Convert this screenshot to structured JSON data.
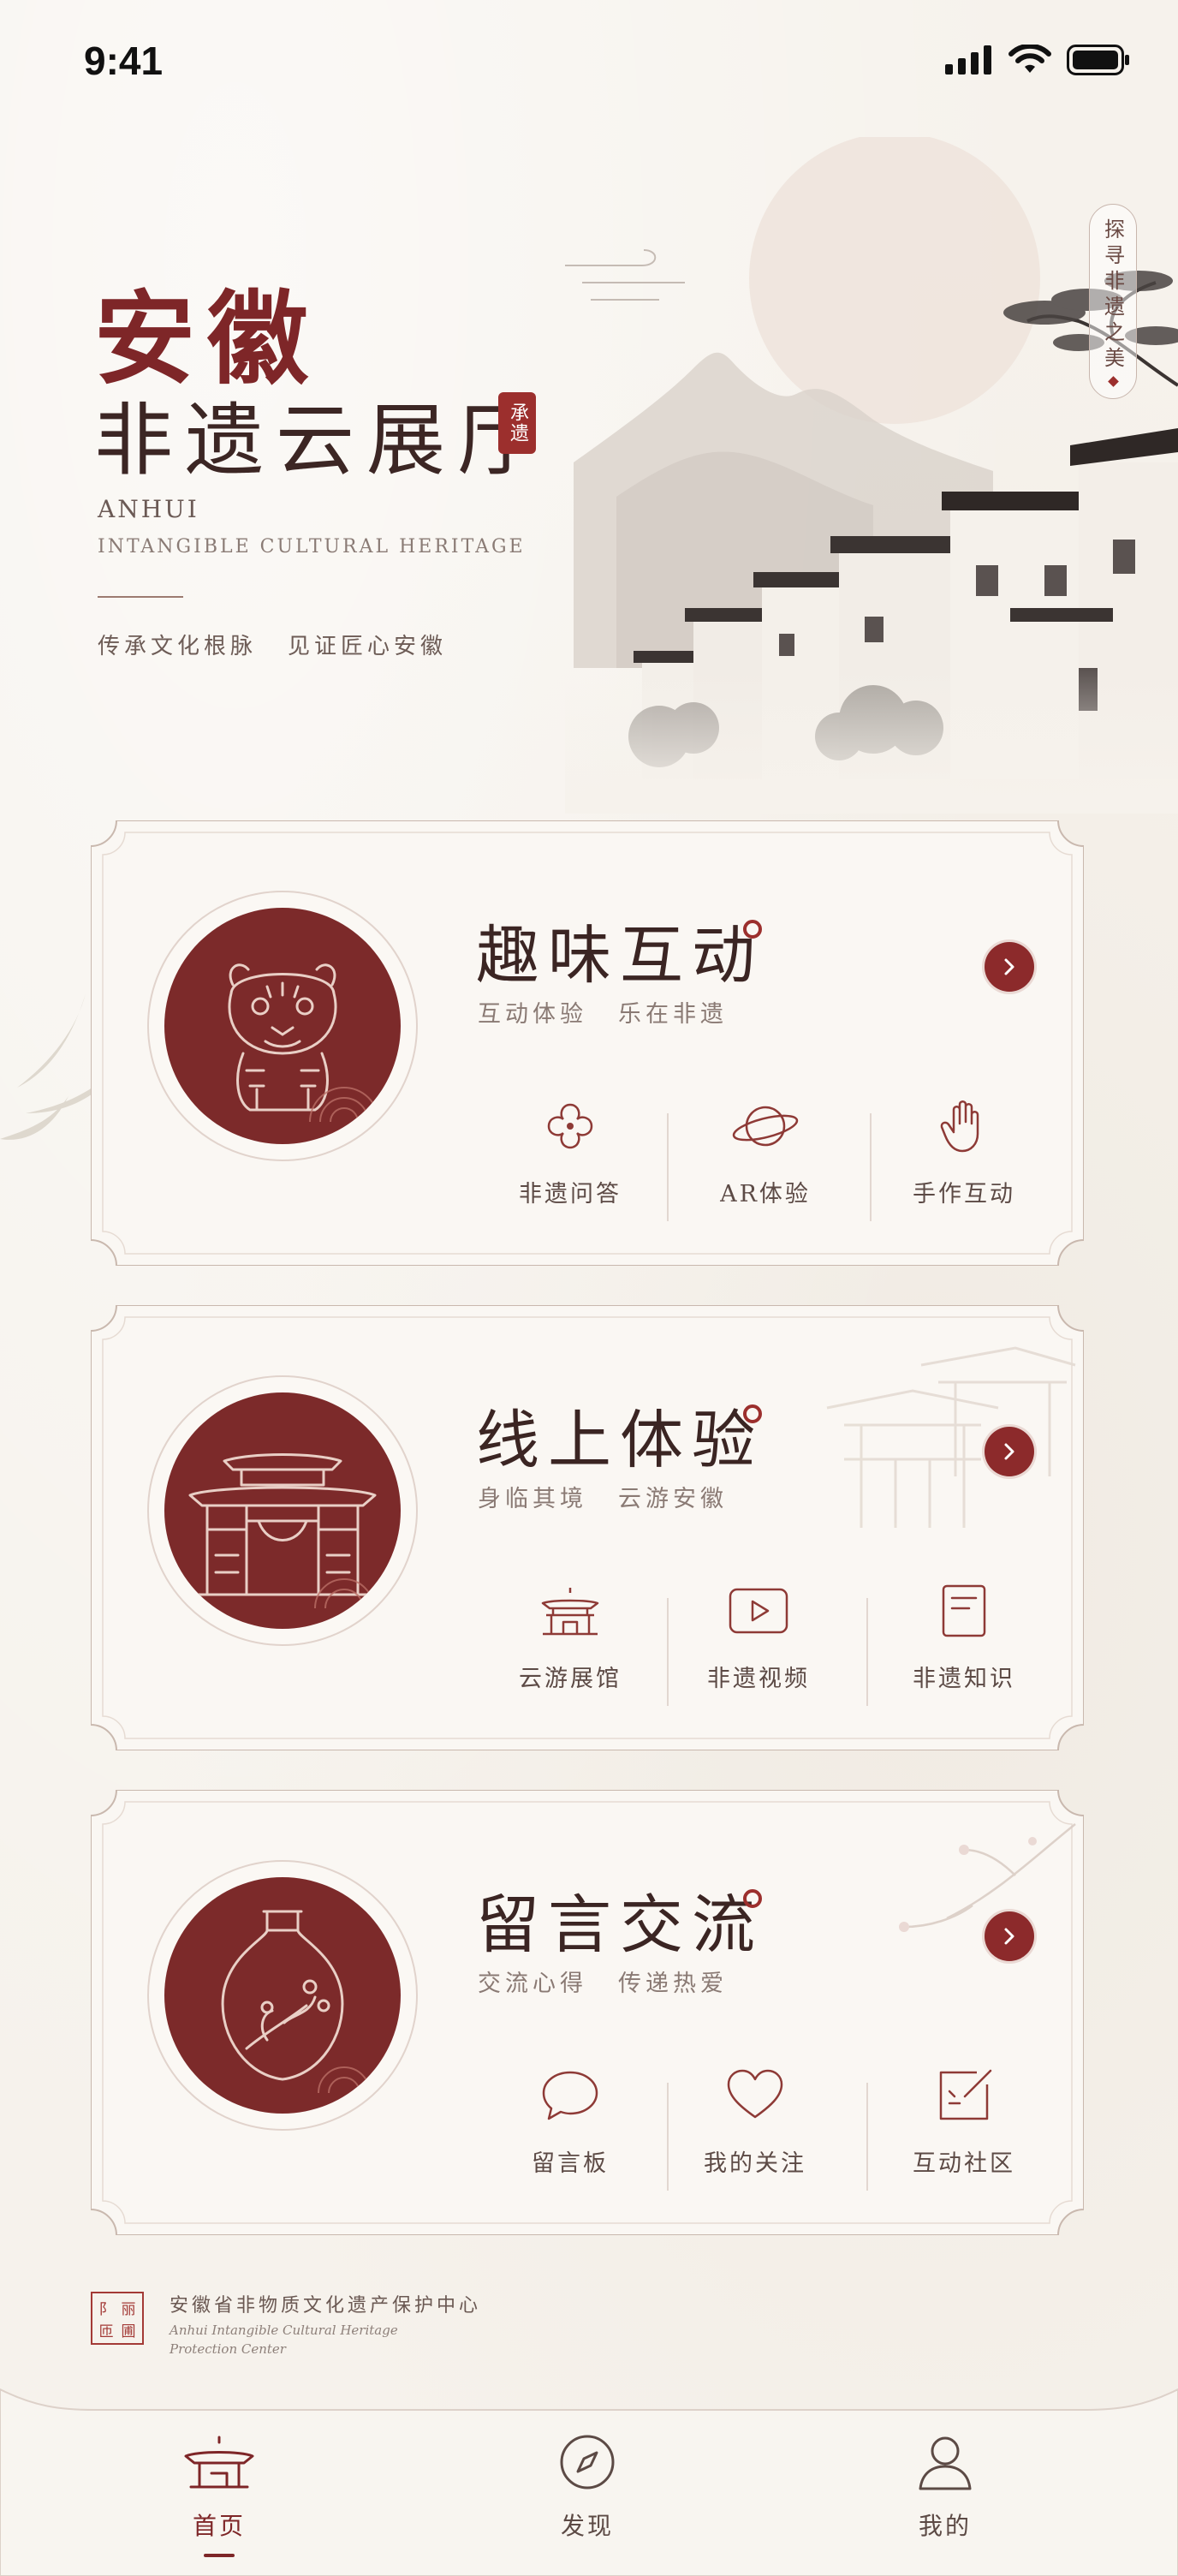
{
  "status_bar": {
    "time": "9:41"
  },
  "hero": {
    "title_line1": "安徽",
    "title_line2": "非遗云展厅",
    "seal_text": "承遗",
    "english_line1": "ANHUI",
    "english_line2": "INTANGIBLE CULTURAL HERITAGE",
    "slogan": [
      "传承文化根脉",
      "见证匠心安徽"
    ],
    "vertical_tag": "探寻非遗之美"
  },
  "cards": [
    {
      "title": "趣味互动",
      "subtitle": [
        "互动体验",
        "乐在非遗"
      ],
      "medal_icon": "tiger-icon",
      "functions": [
        {
          "label": "非遗问答",
          "icon": "clover-icon"
        },
        {
          "label": "AR体验",
          "icon": "planet-icon"
        },
        {
          "label": "手作互动",
          "icon": "hand-icon"
        }
      ]
    },
    {
      "title": "线上体验",
      "subtitle": [
        "身临其境",
        "云游安徽"
      ],
      "medal_icon": "archway-icon",
      "functions": [
        {
          "label": "云游展馆",
          "icon": "pavilion-icon"
        },
        {
          "label": "非遗视频",
          "icon": "video-icon"
        },
        {
          "label": "非遗知识",
          "icon": "book-icon"
        }
      ]
    },
    {
      "title": "留言交流",
      "subtitle": [
        "交流心得",
        "传递热爱"
      ],
      "medal_icon": "vase-icon",
      "functions": [
        {
          "label": "留言板",
          "icon": "chat-bubble-icon"
        },
        {
          "label": "我的关注",
          "icon": "heart-icon"
        },
        {
          "label": "互动社区",
          "icon": "edit-icon"
        }
      ]
    }
  ],
  "organization": {
    "name": "安徽省非物质文化遗产保护中心",
    "english_line1": "Anhui Intangible Cultural Heritage",
    "english_line2": "Protection Center"
  },
  "tabbar": {
    "items": [
      {
        "label": "首页",
        "icon": "home-pavilion-icon",
        "active": true
      },
      {
        "label": "发现",
        "icon": "compass-icon",
        "active": false
      },
      {
        "label": "我的",
        "icon": "user-icon",
        "active": false
      }
    ]
  },
  "colors": {
    "accent": "#7e2628",
    "background": "#f6f2ec",
    "text": "#3b2523"
  }
}
